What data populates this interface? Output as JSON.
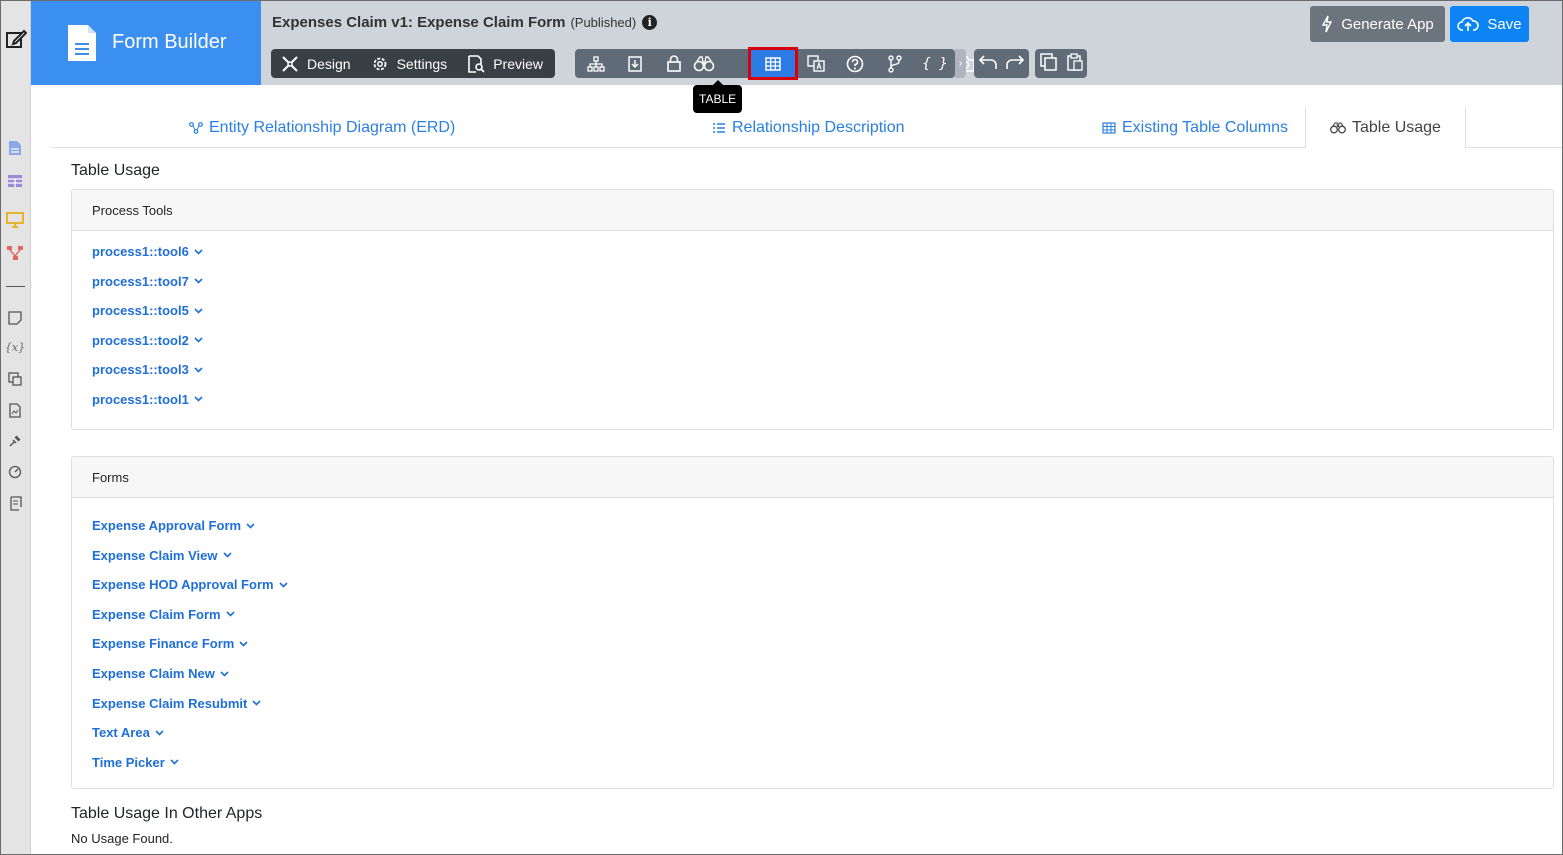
{
  "app": {
    "brand_title": "Form Builder",
    "form_title": "Expenses Claim v1: Expense Claim Form",
    "form_status": "(Published)",
    "info_glyph": "i"
  },
  "mode_buttons": [
    {
      "label": "Design",
      "icon": "design-tools-icon"
    },
    {
      "label": "Settings",
      "icon": "gear-icon"
    },
    {
      "label": "Preview",
      "icon": "preview-icon"
    }
  ],
  "toolbar": {
    "icons": [
      "hierarchy-icon",
      "import-icon",
      "lock-icon",
      "binoculars-icon",
      "table-icon",
      "translate-icon",
      "help-icon",
      "branch-icon",
      "code-braces-icon",
      "camera-icon"
    ],
    "active": "table-icon",
    "tooltip": "TABLE",
    "code_glyph": "{ }",
    "more_glyph": "›"
  },
  "actions": {
    "generate_label": "Generate App",
    "save_label": "Save"
  },
  "tabs": [
    {
      "label": "Entity Relationship Diagram (ERD)",
      "icon": "erd-icon"
    },
    {
      "label": "Relationship Description",
      "icon": "list-icon"
    },
    {
      "label": "Existing Table Columns",
      "icon": "table-icon"
    },
    {
      "label": "Table Usage",
      "icon": "binoculars-icon",
      "active": true
    }
  ],
  "main": {
    "heading": "Table Usage",
    "process_tools": {
      "title": "Process Tools",
      "items": [
        "process1::tool6",
        "process1::tool7",
        "process1::tool5",
        "process1::tool2",
        "process1::tool3",
        "process1::tool1"
      ]
    },
    "forms": {
      "title": "Forms",
      "items": [
        "Expense Approval Form",
        "Expense Claim View",
        "Expense HOD Approval Form",
        "Expense Claim Form",
        "Expense Finance Form",
        "Expense Claim New",
        "Expense Claim Resubmit",
        "Text Area",
        "Time Picker"
      ]
    },
    "other_apps_heading": "Table Usage In Other Apps",
    "other_apps_text": "No Usage Found."
  },
  "sidebar": {
    "variable_glyph": "{x}",
    "icons": [
      "edit-icon",
      "document-icon",
      "table-icon",
      "monitor-icon",
      "workflow-icon",
      "note-icon",
      "variable-icon",
      "translate-icon",
      "image-file-icon",
      "plug-icon",
      "gauge-icon",
      "script-icon"
    ]
  },
  "colors": {
    "brand": "#3b8ff0",
    "link": "#1f6fd8",
    "active_tool": "#2d7be5",
    "highlight": "#d8000c"
  }
}
